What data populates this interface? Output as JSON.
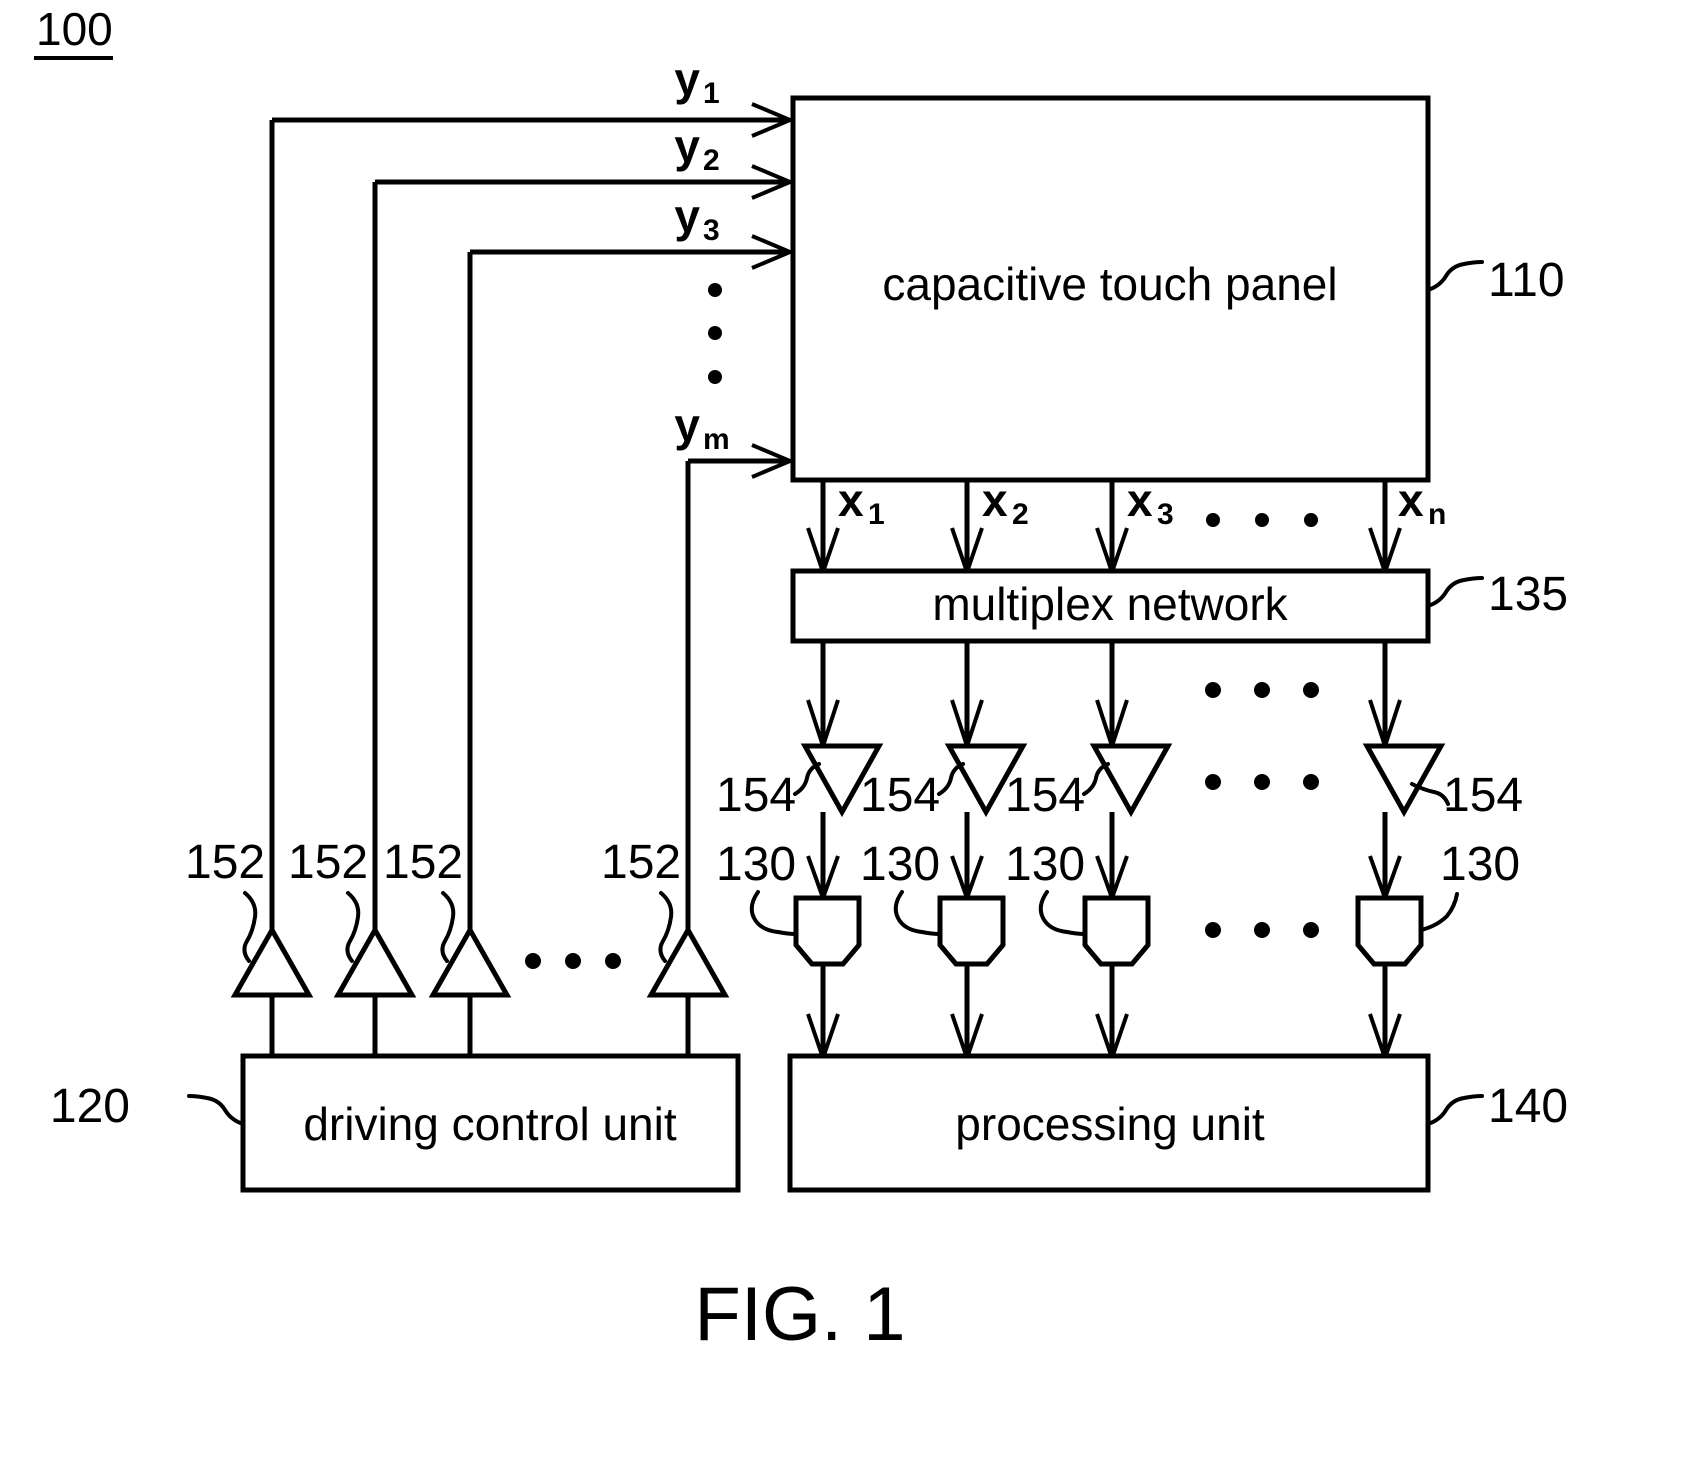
{
  "figure": {
    "system_number": "100",
    "caption": "FIG. 1"
  },
  "blocks": {
    "touch_panel": {
      "label": "capacitive touch panel",
      "ref": "110"
    },
    "multiplex": {
      "label": "multiplex network",
      "ref": "135"
    },
    "driving": {
      "label": "driving control unit",
      "ref": "120"
    },
    "processing": {
      "label": "processing unit",
      "ref": "140"
    }
  },
  "signals": {
    "y": [
      {
        "base": "y",
        "sub": "1"
      },
      {
        "base": "y",
        "sub": "2"
      },
      {
        "base": "y",
        "sub": "3"
      },
      {
        "base": "y",
        "sub": "m"
      }
    ],
    "x": [
      {
        "base": "x",
        "sub": "1"
      },
      {
        "base": "x",
        "sub": "2"
      },
      {
        "base": "x",
        "sub": "3"
      },
      {
        "base": "x",
        "sub": "n"
      }
    ]
  },
  "components": {
    "driver_amplifier_ref": "152",
    "driver_amplifier_refs": [
      "152",
      "152",
      "152",
      "152"
    ],
    "sense_amplifier_ref": "154",
    "sense_amplifier_refs": [
      "154",
      "154",
      "154",
      "154"
    ],
    "adc_ref": "130",
    "adc_refs": [
      "130",
      "130",
      "130",
      "130"
    ]
  },
  "ellipsis": {
    "glyph": "•"
  }
}
